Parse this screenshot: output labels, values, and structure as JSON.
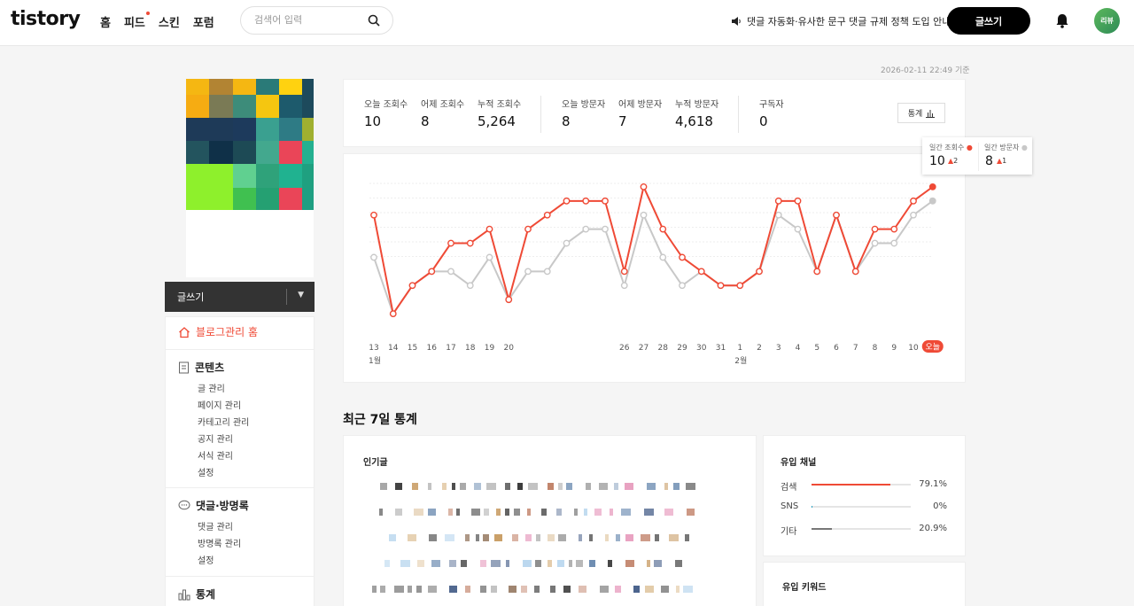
{
  "header": {
    "logo": "tistory",
    "nav": [
      {
        "label": "홈",
        "dot": false
      },
      {
        "label": "피드",
        "dot": true
      },
      {
        "label": "스킨",
        "dot": false
      },
      {
        "label": "포럼",
        "dot": false
      }
    ],
    "search_placeholder": "검색어 입력",
    "notice": "댓글 자동화·유사한 문구 댓글 규제 정책 도입 안내",
    "write_button": "글쓰기",
    "avatar_text": "리뷰"
  },
  "timestamp": "2026-02-11 22:49 기준",
  "sidebar": {
    "write_button": "글쓰기",
    "home": "블로그관리 홈",
    "sections": [
      {
        "title": "콘텐츠",
        "items": [
          "글 관리",
          "페이지 관리",
          "카테고리 관리",
          "공지 관리",
          "서식 관리",
          "설정"
        ]
      },
      {
        "title": "댓글·방명록",
        "items": [
          "댓글 관리",
          "방명록 관리",
          "설정"
        ]
      },
      {
        "title": "통계",
        "items": []
      }
    ]
  },
  "stats": {
    "items": [
      {
        "label": "오늘 조회수",
        "value": "10"
      },
      {
        "label": "어제 조회수",
        "value": "8"
      },
      {
        "label": "누적 조회수",
        "value": "5,264"
      },
      {
        "label": "오늘 방문자",
        "value": "8"
      },
      {
        "label": "어제 방문자",
        "value": "7"
      },
      {
        "label": "누적 방문자",
        "value": "4,618"
      },
      {
        "label": "구독자",
        "value": "0"
      }
    ],
    "button": "통계"
  },
  "tooltip": {
    "views_label": "일간 조회수",
    "views_value": "10",
    "views_delta": "2",
    "visitors_label": "일간 방문자",
    "visitors_value": "8",
    "visitors_delta": "1"
  },
  "chart_data": {
    "type": "line",
    "x_tick_labels": [
      "13",
      "14",
      "15",
      "16",
      "17",
      "18",
      "19",
      "20",
      "",
      "",
      "",
      "",
      "",
      "26",
      "27",
      "28",
      "29",
      "30",
      "31",
      "1",
      "2",
      "3",
      "4",
      "5",
      "6",
      "7",
      "8",
      "9",
      "10",
      "오늘"
    ],
    "month_labels": [
      {
        "label": "1월",
        "index": 0
      },
      {
        "label": "2월",
        "index": 19
      }
    ],
    "series": [
      {
        "color": "#ef4a36",
        "values": [
          8,
          1,
          3,
          4,
          6,
          6,
          7,
          2,
          7,
          8,
          9,
          9,
          9,
          4,
          10,
          7,
          5,
          4,
          3,
          3,
          4,
          9,
          9,
          4,
          8,
          4,
          7,
          7,
          9,
          10
        ]
      },
      {
        "color": "#c8c8c8",
        "values": [
          5,
          1,
          3,
          4,
          4,
          3,
          5,
          2,
          4,
          4,
          6,
          7,
          7,
          3,
          8,
          5,
          3,
          4,
          3,
          3,
          4,
          8,
          7,
          4,
          8,
          4,
          6,
          6,
          8,
          9
        ]
      }
    ],
    "ylim": [
      0,
      11
    ]
  },
  "recent_section_title": "최근 7일 통계",
  "popular": {
    "title": "인기글"
  },
  "channels": {
    "title": "유입 채널",
    "items": [
      {
        "label": "검색",
        "percent": "79.1%",
        "fraction": 0.791,
        "color": "#ef4a36"
      },
      {
        "label": "SNS",
        "percent": "0%",
        "fraction": 0.005,
        "color": "#27a0c2"
      },
      {
        "label": "기타",
        "percent": "20.9%",
        "fraction": 0.209,
        "color": "#777777"
      }
    ]
  },
  "keywords": {
    "title": "유입 키워드"
  },
  "colors": {
    "accent": "#ef4a36",
    "secondary": "#c8c8c8"
  }
}
